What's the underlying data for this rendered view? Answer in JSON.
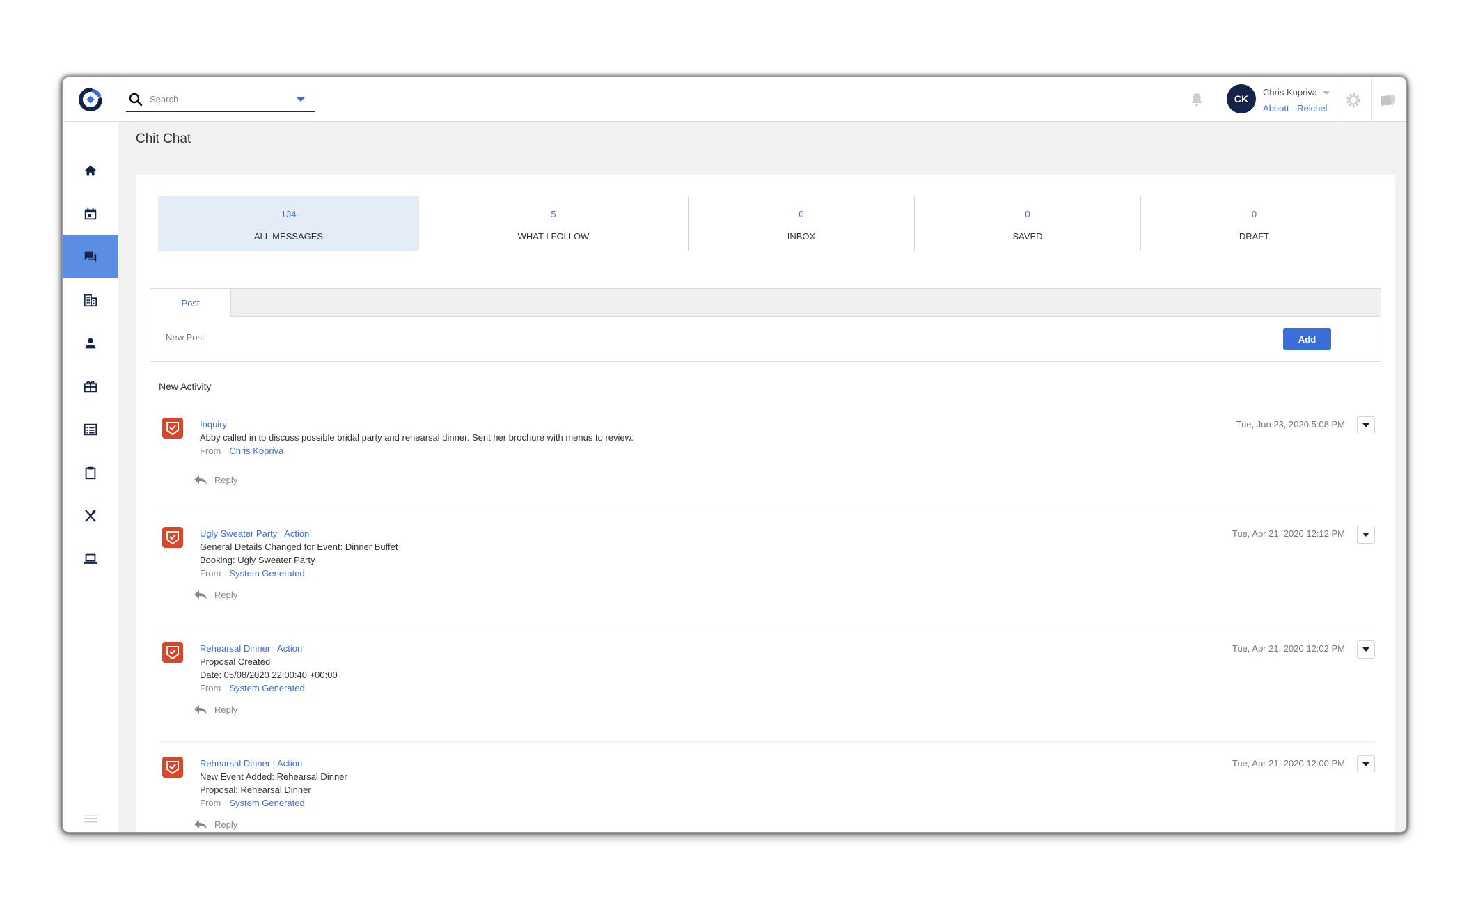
{
  "search": {
    "placeholder": "Search"
  },
  "user": {
    "initials": "CK",
    "name": "Chris Kopriva",
    "company": "Abbott - Reichel"
  },
  "sidebar": {
    "items": [
      {
        "icon": "home-icon"
      },
      {
        "icon": "calendar-icon"
      },
      {
        "icon": "chat-icon",
        "active": true
      },
      {
        "icon": "building-icon"
      },
      {
        "icon": "person-icon"
      },
      {
        "icon": "gift-icon"
      },
      {
        "icon": "list-icon"
      },
      {
        "icon": "clipboard-icon"
      },
      {
        "icon": "utensils-icon"
      },
      {
        "icon": "laptop-icon"
      }
    ]
  },
  "page": {
    "title": "Chit Chat"
  },
  "stats": [
    {
      "count": "134",
      "label": "ALL MESSAGES",
      "active": true
    },
    {
      "count": "5",
      "label": "WHAT I FOLLOW"
    },
    {
      "count": "0",
      "label": "INBOX"
    },
    {
      "count": "0",
      "label": "SAVED"
    },
    {
      "count": "0",
      "label": "DRAFT"
    }
  ],
  "post": {
    "tab_label": "Post",
    "placeholder": "New Post",
    "add_label": "Add"
  },
  "activity": {
    "title": "New Activity",
    "from_label": "From",
    "reply_label": "Reply",
    "items": [
      {
        "title": "Inquiry",
        "lines": [
          "Abby called in to discuss possible bridal party and rehearsal dinner.  Sent her brochure with menus to review."
        ],
        "from": "Chris Kopriva",
        "date": "Tue, Jun 23, 2020 5:08 PM"
      },
      {
        "title": "Ugly Sweater Party | Action",
        "lines": [
          "General Details Changed for Event: Dinner Buffet",
          "Booking: Ugly Sweater Party"
        ],
        "from": "System Generated",
        "date": "Tue, Apr 21, 2020 12:12 PM"
      },
      {
        "title": "Rehearsal Dinner | Action",
        "lines": [
          "Proposal Created",
          "Date: 05/08/2020 22:00:40 +00:00"
        ],
        "from": "System Generated",
        "date": "Tue, Apr 21, 2020 12:02 PM"
      },
      {
        "title": "Rehearsal Dinner | Action",
        "lines": [
          "New Event Added: Rehearsal Dinner",
          "Proposal: Rehearsal Dinner"
        ],
        "from": "System Generated",
        "date": "Tue, Apr 21, 2020 12:00 PM"
      }
    ]
  },
  "colors": {
    "accent": "#3a6fd8",
    "sidebar_active": "#5b8ee2",
    "avatar": "#15234a",
    "activity_icon": "#d9472b"
  }
}
